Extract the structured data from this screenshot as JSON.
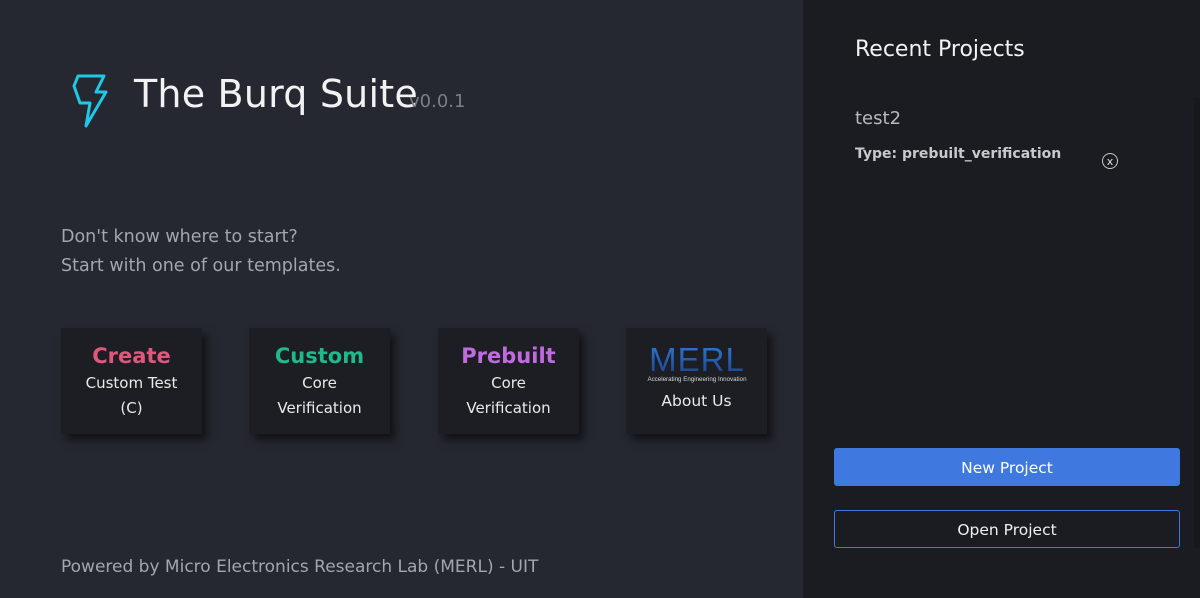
{
  "app": {
    "title": "The Burq Suite",
    "version": "v0.0.1",
    "logo_icon": "lightning-bolt-icon",
    "accent_color": "#1ec8e6"
  },
  "intro": {
    "line1": "Don't know where to start?",
    "line2": "Start with one of our templates."
  },
  "templates": [
    {
      "title": "Create",
      "line1": "Custom Test",
      "line2": "(C)",
      "color": "#e0577c"
    },
    {
      "title": "Custom",
      "line1": "Core",
      "line2": "Verification",
      "color": "#1fb98e"
    },
    {
      "title": "Prebuilt",
      "line1": "Core",
      "line2": "Verification",
      "color": "#c26be0"
    }
  ],
  "about": {
    "logo_text": "MERL",
    "logo_tagline": "Accelerating Engineering Innovation",
    "label": "About Us"
  },
  "footer": {
    "text": "Powered by Micro Electronics Research Lab (MERL) - UIT"
  },
  "sidebar": {
    "title": "Recent Projects",
    "recent": [
      {
        "name": "test2",
        "type": "Type: prebuilt_verification",
        "remove_label": "x"
      }
    ],
    "new_project_label": "New Project",
    "open_project_label": "Open Project"
  },
  "colors": {
    "main_bg": "#252830",
    "sidebar_bg": "#1b1c21",
    "primary_button": "#3f78de"
  }
}
